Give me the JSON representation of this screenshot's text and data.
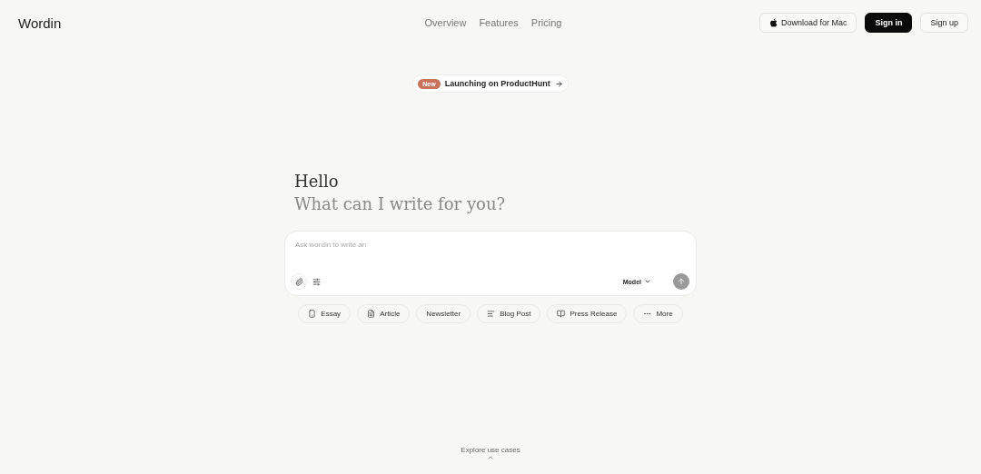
{
  "brand": "Wordin",
  "nav": [
    {
      "label": "Overview"
    },
    {
      "label": "Features"
    },
    {
      "label": "Pricing"
    }
  ],
  "actions": [
    {
      "kind": "download",
      "label": "Download for Mac"
    },
    {
      "kind": "primary",
      "label": "Sign in"
    },
    {
      "kind": "outline",
      "label": "Sign up"
    }
  ],
  "announcement": {
    "badge": "New",
    "text": "Launching on ProductHunt"
  },
  "greeting": {
    "title": "Hello",
    "subtitle": "What can I write for you?"
  },
  "composer": {
    "placeholder": "Ask wordin to write an",
    "model": "Model"
  },
  "chips": [
    {
      "kind": "essay",
      "label": "Essay"
    },
    {
      "kind": "article",
      "label": "Article"
    },
    {
      "kind": "plain",
      "label": "Newsletter"
    },
    {
      "kind": "blog",
      "label": "Blog Post"
    },
    {
      "kind": "press",
      "label": "Press Release"
    },
    {
      "kind": "more",
      "label": "More"
    }
  ],
  "footer": {
    "link": "Explore use cases"
  }
}
